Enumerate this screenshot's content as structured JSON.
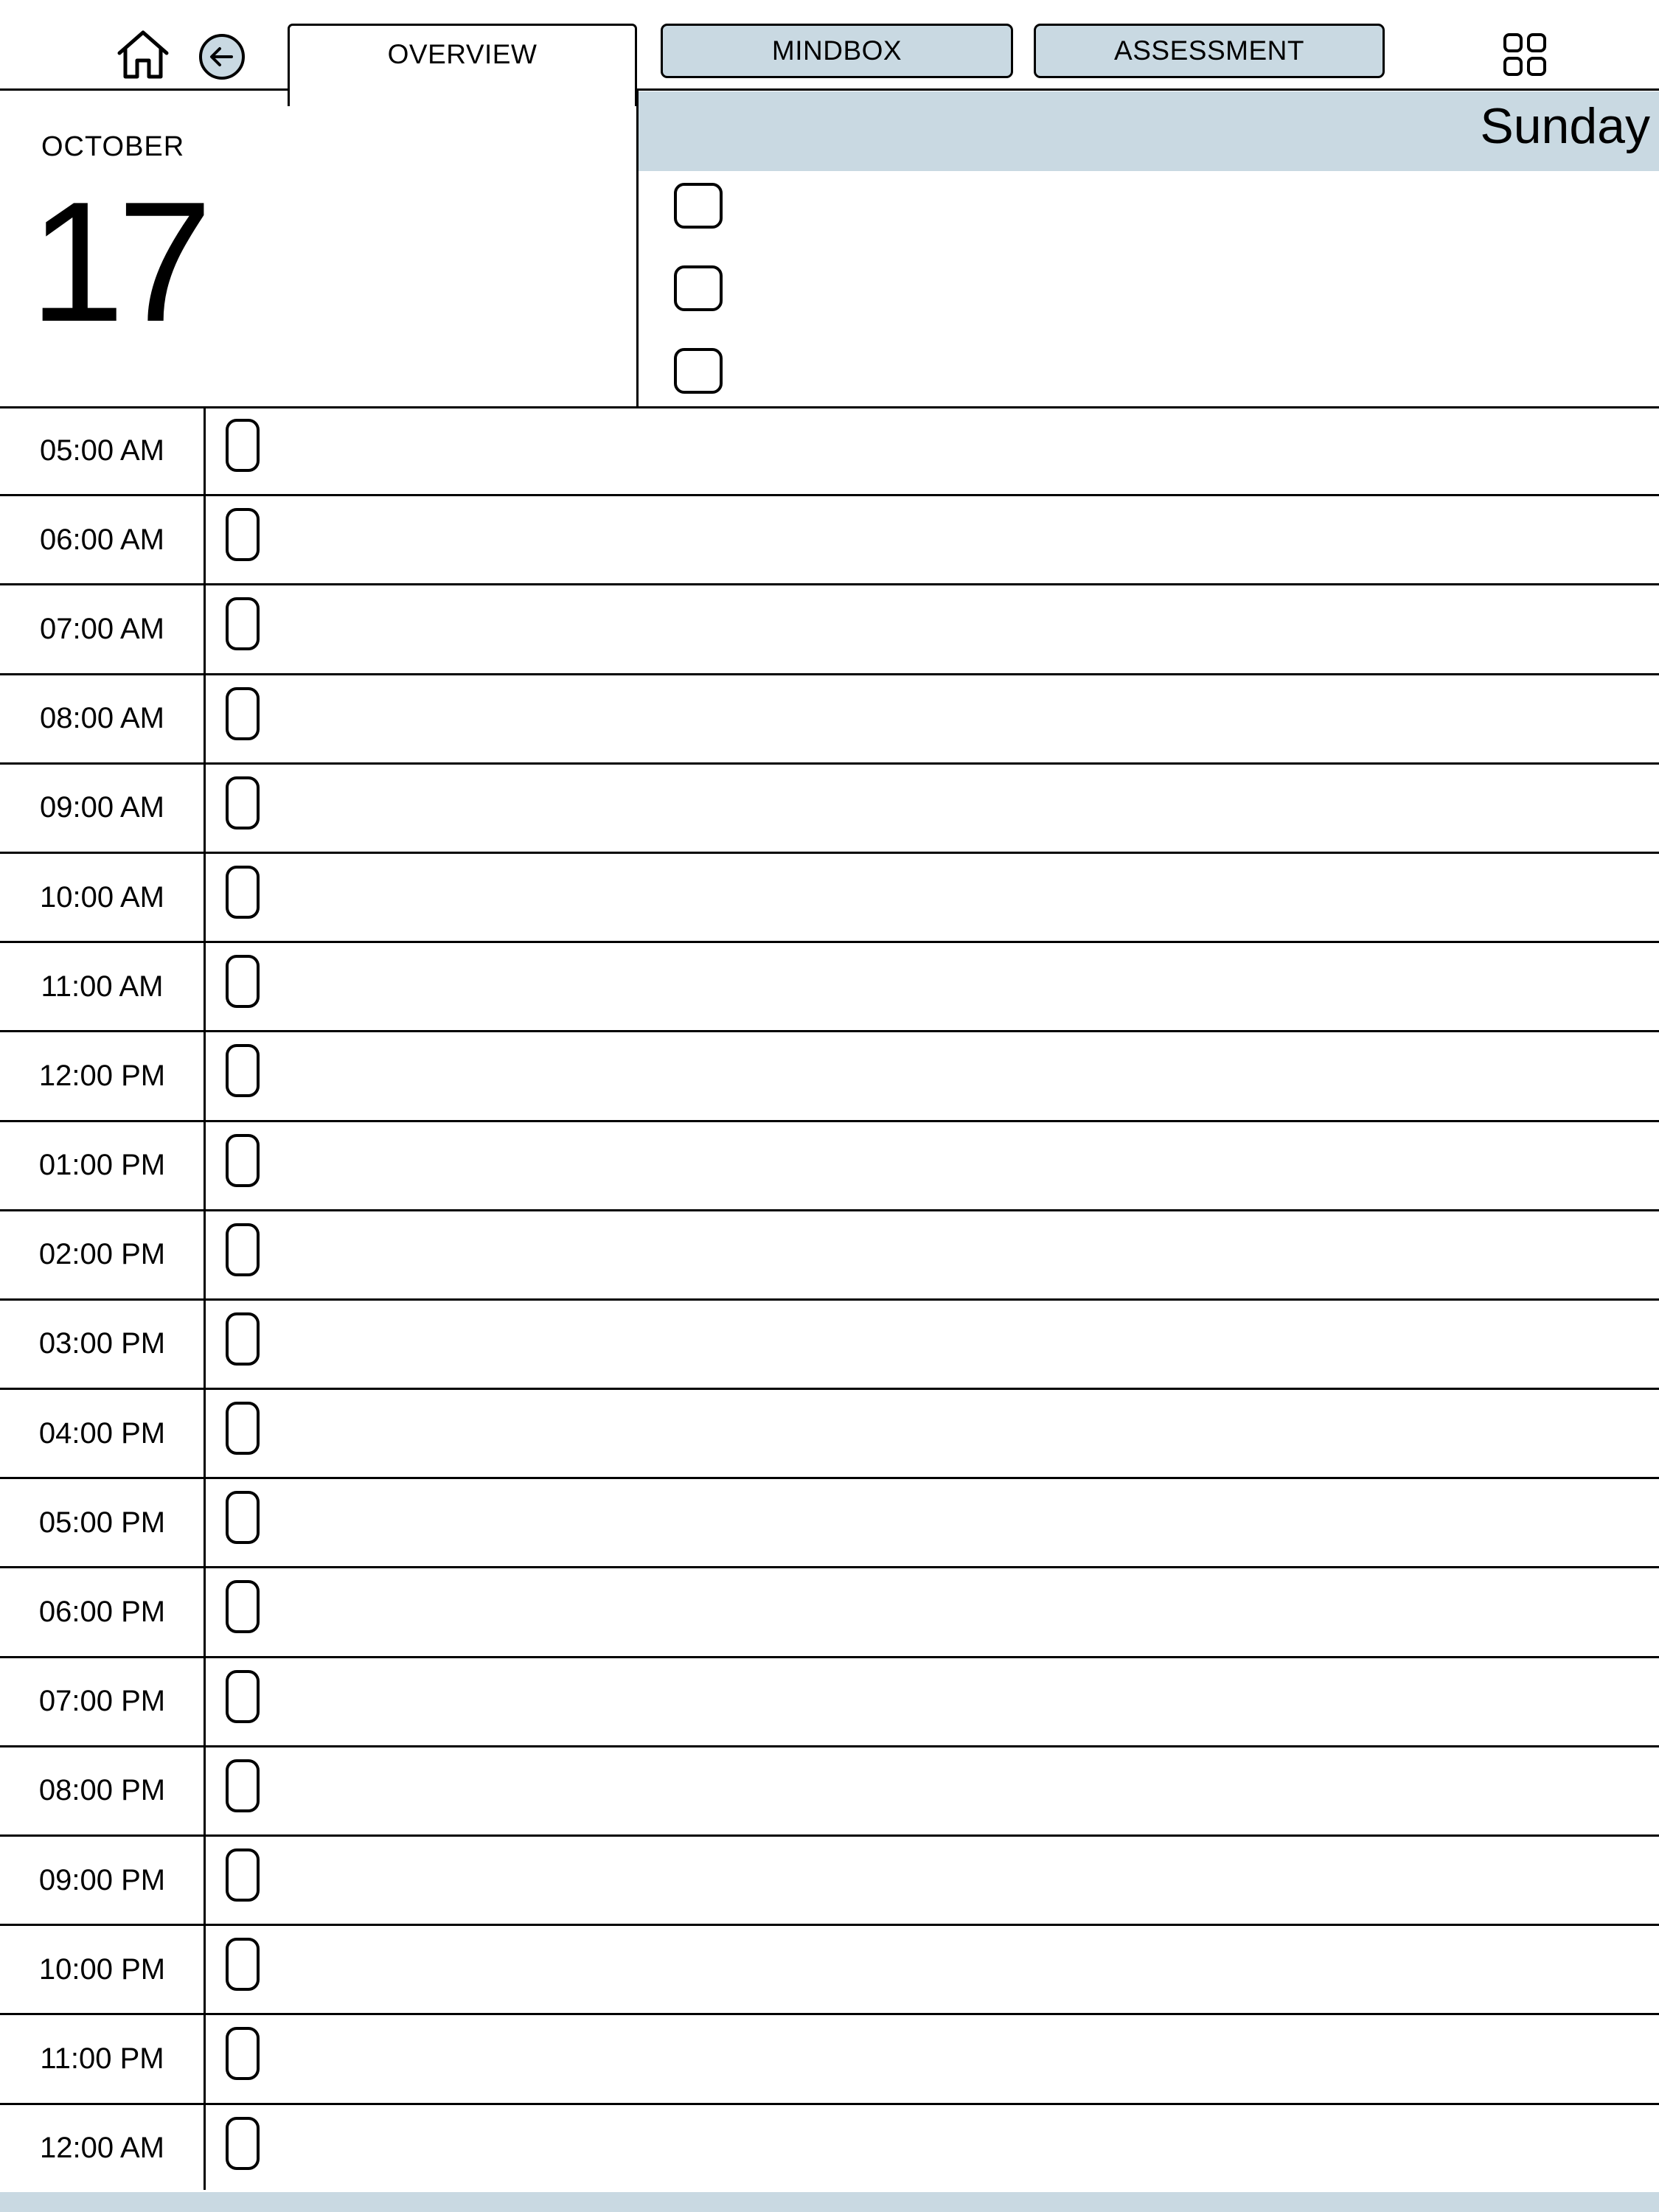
{
  "nav": {
    "home_icon": "home-icon",
    "back_icon": "arrow-left-circle-icon",
    "grid_icon": "grid-icon",
    "tabs": [
      {
        "label": "OVERVIEW",
        "active": true
      },
      {
        "label": "MINDBOX",
        "active": false
      },
      {
        "label": "ASSESSMENT",
        "active": false
      }
    ]
  },
  "date": {
    "month": "OCTOBER",
    "day": "17",
    "weekday": "Sunday"
  },
  "top_tasks": {
    "count": 3
  },
  "schedule": {
    "times": [
      "05:00 AM",
      "06:00 AM",
      "07:00 AM",
      "08:00 AM",
      "09:00 AM",
      "10:00 AM",
      "11:00 AM",
      "12:00 PM",
      "01:00 PM",
      "02:00 PM",
      "03:00 PM",
      "04:00 PM",
      "05:00 PM",
      "06:00 PM",
      "07:00 PM",
      "08:00 PM",
      "09:00 PM",
      "10:00 PM",
      "11:00 PM",
      "12:00 AM"
    ]
  },
  "colors": {
    "accent": "#c9d9e2",
    "line": "#000000",
    "background": "#ffffff"
  }
}
